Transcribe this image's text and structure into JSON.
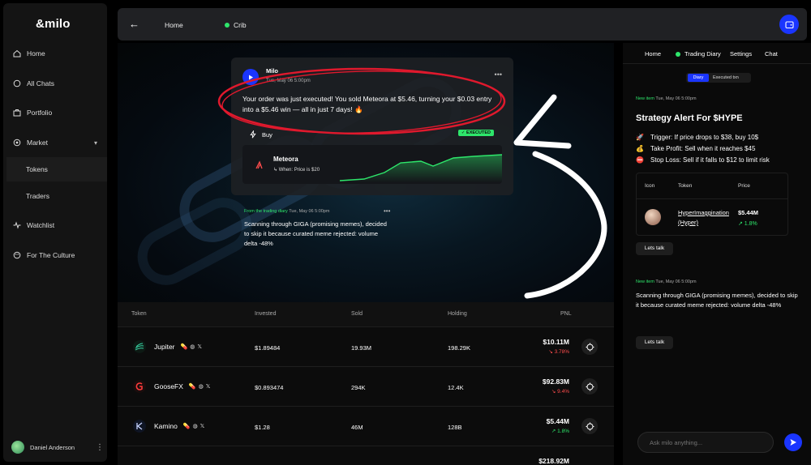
{
  "sidebar": {
    "logo": "&milo",
    "items": [
      {
        "label": "Home"
      },
      {
        "label": "All Chats"
      },
      {
        "label": "Portfolio"
      },
      {
        "label": "Market"
      },
      {
        "label": "Tokens"
      },
      {
        "label": "Traders"
      },
      {
        "label": "Watchlist"
      },
      {
        "label": "For The Culture"
      }
    ],
    "user": "Daniel Anderson"
  },
  "topbar": {
    "home": "Home",
    "crib": "Crib"
  },
  "hero": {
    "card": {
      "name": "Milo",
      "date": "Tue, May 06 5:00pm",
      "message": "Your order was just executed! You sold Meteora at $5.46, turning your $0.03 entry into a $5.46 win — all in just 7 days! 🔥",
      "buy_label": "Buy",
      "status": "✓ EXECUTED",
      "token": "Meteora",
      "condition": "When: Price is $20"
    },
    "diary": {
      "label": "From the trading diary",
      "date": "Tue, May 06 5:00pm",
      "text": "Scanning through GIGA (promising memes), decided to skip it because curated meme rejected: volume delta -48%"
    }
  },
  "table": {
    "headers": {
      "token": "Token",
      "invested": "Invested",
      "sold": "Sold",
      "holding": "Holding",
      "pnl": "PNL"
    },
    "rows": [
      {
        "token": "Jupiter",
        "invested": "$1.89484",
        "sold": "19.93M",
        "holding": "198.29K",
        "pnl": "$10.11M",
        "change": "↘ 3.78%",
        "dir": "down"
      },
      {
        "token": "GooseFX",
        "invested": "$0.893474",
        "sold": "294K",
        "holding": "12.4K",
        "pnl": "$92.83M",
        "change": "↘ 9.4%",
        "dir": "down"
      },
      {
        "token": "Kamino",
        "invested": "$1.28",
        "sold": "46M",
        "holding": "128B",
        "pnl": "$5.44M",
        "change": "↗ 1.8%",
        "dir": "up"
      },
      {
        "token": "",
        "invested": "",
        "sold": "",
        "holding": "",
        "pnl": "$218.92M",
        "change": "",
        "dir": "up"
      }
    ]
  },
  "right": {
    "tabs": [
      "Home",
      "Trading Diary",
      "Settings",
      "Chat"
    ],
    "segment": {
      "on": "Diary",
      "off": "Executed txn"
    },
    "item1": {
      "label": "New item",
      "date": "Tue, May 06 5:00pm"
    },
    "strategy": {
      "title": "Strategy Alert For $HYPE",
      "lines": [
        {
          "emoji": "🚀",
          "text": "Trigger: If price drops to $38, buy 10$"
        },
        {
          "emoji": "💰",
          "text": "Take Profit: Sell when it reaches $45"
        },
        {
          "emoji": "⛔",
          "text": "Stop Loss: Sell if it falls to $12 to limit risk"
        }
      ]
    },
    "mini_table": {
      "headers": {
        "icon": "Icon",
        "token": "Token",
        "price": "Price"
      },
      "token": "HyperImaggination (Hyper)",
      "price": "$5.44M",
      "change": "↗ 1.8%"
    },
    "talk1": "Lets talk",
    "item2": {
      "label": "New item",
      "date": "Tue, May 06 5:00pm"
    },
    "text2": "Scanning through GIGA (promising memes), decided to skip it because curated meme rejected: volume delta -48%",
    "talk2": "Lets talk",
    "ask_placeholder": "Ask milo anything..."
  },
  "colors": {
    "accent": "#1a35ff",
    "positive": "#2ee66b",
    "negative": "#ff4d4d",
    "annotation": "#e0192d"
  }
}
